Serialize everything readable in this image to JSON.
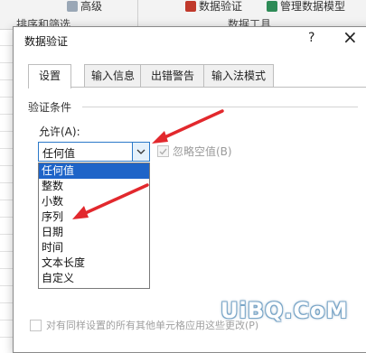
{
  "ribbon": {
    "advanced_label": "高级",
    "sort_filter_group": "排序和筛选",
    "data_validation_label": "数据验证",
    "manage_model_label": "管理数据模型",
    "data_tools_group": "数据工具"
  },
  "dialog": {
    "title": "数据验证",
    "help": "?",
    "close": "×",
    "tabs": [
      {
        "label": "设置"
      },
      {
        "label": "输入信息"
      },
      {
        "label": "出错警告"
      },
      {
        "label": "输入法模式"
      }
    ],
    "section_label": "验证条件",
    "allow_label": "允许(A):",
    "allow_value": "任何值",
    "ignore_blank_label": "忽略空值(B)",
    "options": [
      "任何值",
      "整数",
      "小数",
      "序列",
      "日期",
      "时间",
      "文本长度",
      "自定义"
    ],
    "footer_label": "对有同样设置的所有其他单元格应用这些更改(P)"
  },
  "colors": {
    "selected_bg": "#1e64c8",
    "arrow_red": "#e2282d",
    "focus_border": "#2b79c9"
  },
  "watermark": "UiBQ.CoM"
}
